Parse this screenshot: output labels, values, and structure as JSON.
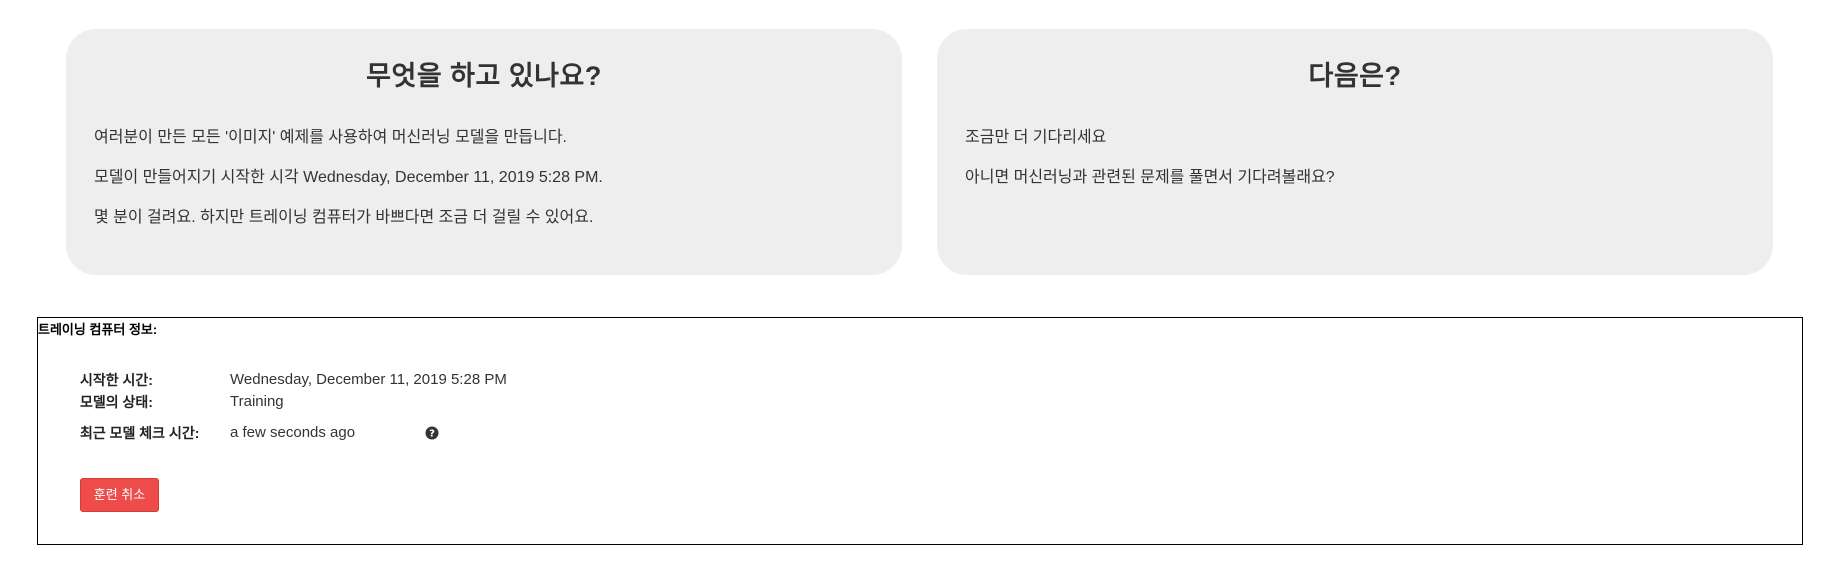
{
  "cards": {
    "left": {
      "title": "무엇을 하고 있나요?",
      "paragraphs": [
        "여러분이 만든 모든 '이미지' 예제를 사용하여 머신러닝 모델을 만듭니다.",
        "모델이 만들어지기 시작한 시각 Wednesday, December 11, 2019 5:28 PM.",
        "몇 분이 걸려요. 하지만 트레이닝 컴퓨터가 바쁘다면 조금 더 걸릴 수 있어요."
      ]
    },
    "right": {
      "title": "다음은?",
      "paragraphs": [
        "조금만 더 기다리세요",
        "아니면 머신러닝과 관련된 문제를 풀면서 기다려볼래요?"
      ]
    }
  },
  "training_info": {
    "title": "트레이닝 컴퓨터 정보:",
    "rows": [
      {
        "label": "시작한 시간:",
        "value": "Wednesday, December 11, 2019 5:28 PM"
      },
      {
        "label": "모델의 상태:",
        "value": "Training"
      },
      {
        "label": "최근 모델 체크 시간:",
        "value": "a few seconds ago"
      }
    ],
    "help_icon": "question-circle-icon",
    "cancel_button_label": "훈련 취소",
    "cancel_button_color": "#ee4b4b"
  }
}
